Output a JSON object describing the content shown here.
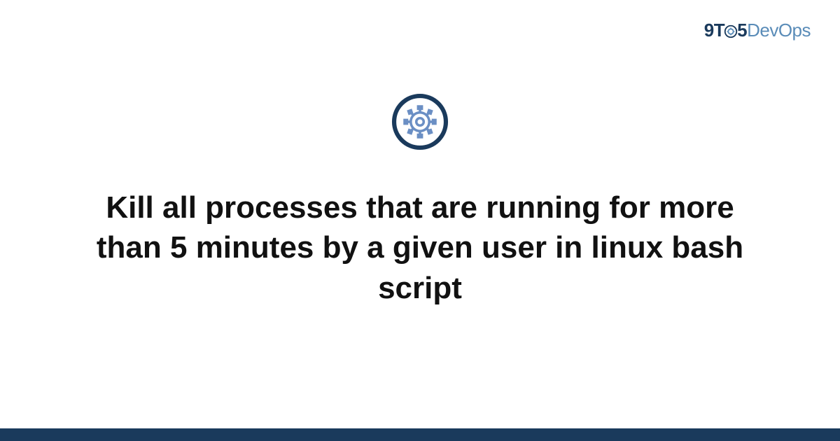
{
  "logo": {
    "part1": "9T",
    "part2": "5",
    "part3": "DevOps"
  },
  "title": "Kill all processes that are running for more than 5 minutes by a given user in linux bash script",
  "colors": {
    "brandDark": "#1a3a5c",
    "brandLight": "#5a8cb8",
    "iconStroke": "#1a3a5c",
    "iconInner": "#6b8fc4"
  }
}
